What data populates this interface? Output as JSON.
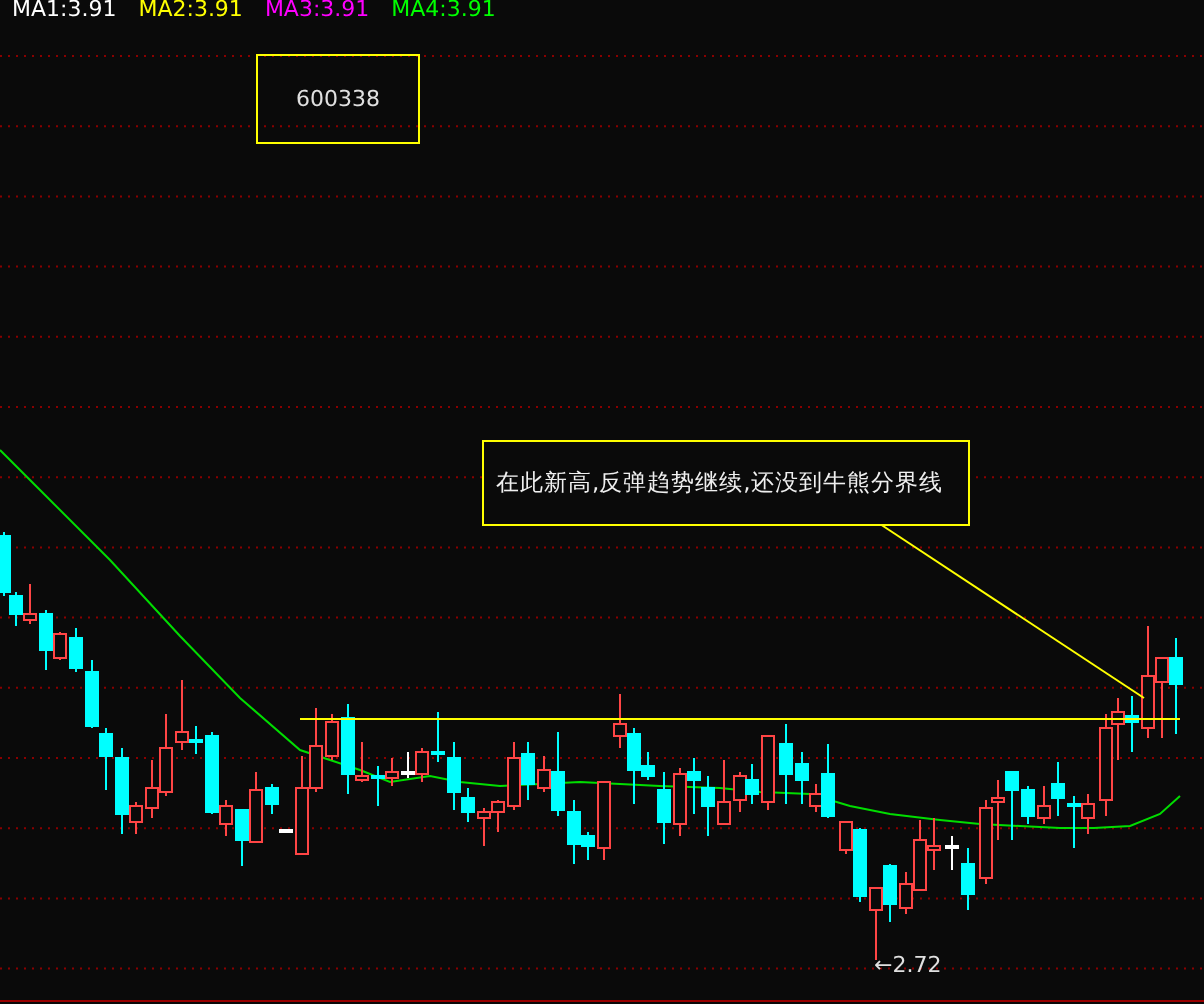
{
  "legend": [
    {
      "label": "MA1:3.91",
      "color": "#ffffff"
    },
    {
      "label": "MA2:3.91",
      "color": "#ffff00"
    },
    {
      "label": "MA3:3.91",
      "color": "#ff00ff"
    },
    {
      "label": "MA4:3.91",
      "color": "#00ff00"
    }
  ],
  "stock_code": "600338",
  "annotation": "在此新高,反弹趋势继续,还没到牛熊分界线",
  "low_marker": "←2.72"
}
